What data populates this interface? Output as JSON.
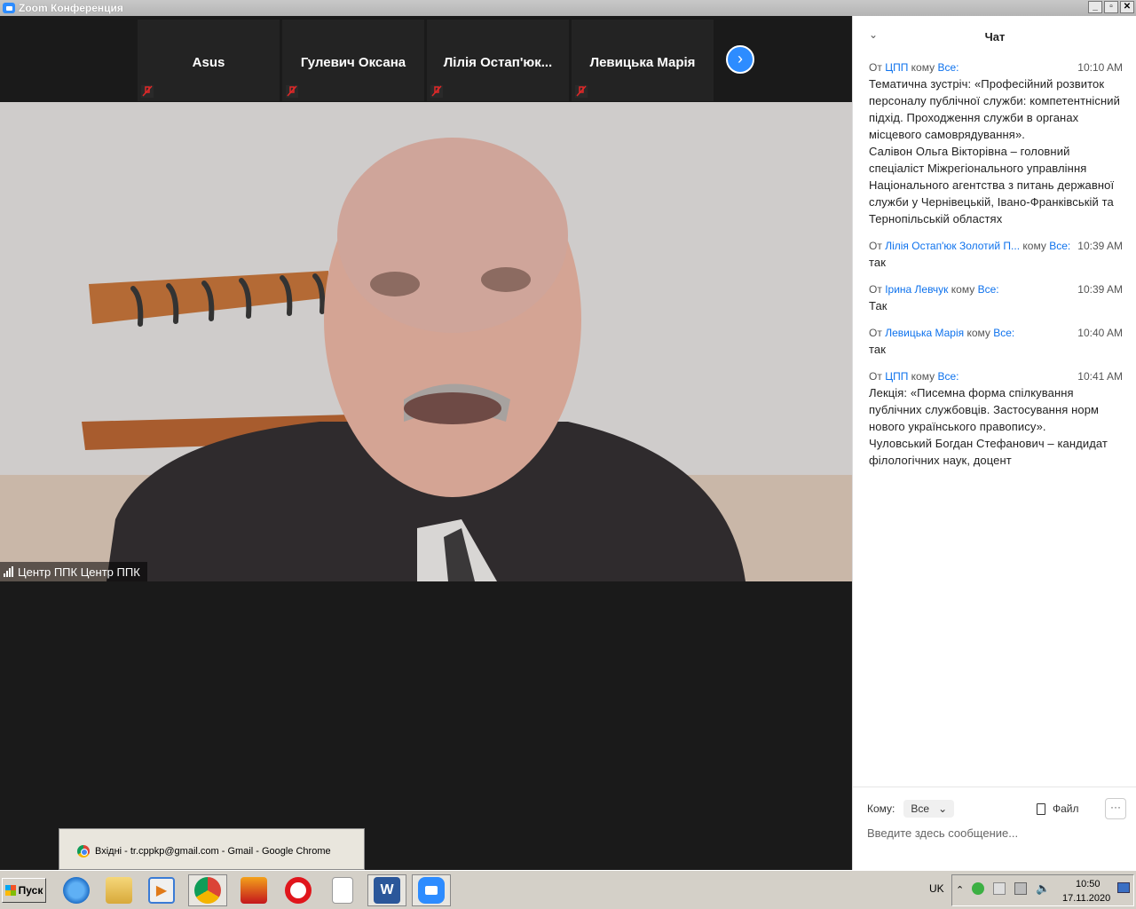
{
  "window": {
    "title": "Zoom Конференция"
  },
  "participants": [
    {
      "name": "Asus"
    },
    {
      "name": "Гулевич Оксана"
    },
    {
      "name": "Лілія  Остап'юк..."
    },
    {
      "name": "Левицька Марія"
    }
  ],
  "speaker": {
    "label": "Центр ППК Центр ППК"
  },
  "chat": {
    "title": "Чат",
    "messages": [
      {
        "from_prefix": "От",
        "from": "ЦПП",
        "to_prefix": "кому",
        "to": "Все:",
        "time": "10:10 AM",
        "text": "Тематична зустріч: «Професійний розвиток персоналу публічної служби: компетентнісний підхід. Проходження служби в органах місцевого самоврядування».\nСалівон Ольга Вікторівна – головний спеціаліст Міжрегіонального управління Національного агентства з питань державної служби у Чернівецькій, Івано-Франківській та Тернопільській областях"
      },
      {
        "from_prefix": "От",
        "from": "Лілія Остап'юк Золотий П...",
        "to_prefix": "кому",
        "to": "Все:",
        "time": "10:39 AM",
        "text": "так"
      },
      {
        "from_prefix": "От",
        "from": "Ірина Левчук",
        "to_prefix": "кому",
        "to": "Все:",
        "time": "10:39 AM",
        "text": "Так"
      },
      {
        "from_prefix": "От",
        "from": "Левицька Марія",
        "to_prefix": "кому",
        "to": "Все:",
        "time": "10:40 AM",
        "text": "так"
      },
      {
        "from_prefix": "От",
        "from": "ЦПП",
        "to_prefix": "кому",
        "to": "Все:",
        "time": "10:41 AM",
        "text": "Лекція: «Писемна форма спілкування публічних службовців. Застосування норм нового українського правопису».\nЧуловський Богдан Стефанович – кандидат філологічних наук, доцент"
      }
    ],
    "composer": {
      "to_label": "Кому:",
      "to_value": "Все",
      "file_label": "Файл",
      "more_label": "···",
      "placeholder": "Введите здесь сообщение..."
    }
  },
  "popup": {
    "text": "Вхідні - tr.cppkp@gmail.com - Gmail - Google Chrome"
  },
  "taskbar": {
    "start_label": "Пуск",
    "lang": "UK",
    "time": "10:50",
    "date": "17.11.2020",
    "icons": [
      "internet-explorer-icon",
      "explorer-icon",
      "media-player-icon",
      "chrome-icon",
      "app-icon",
      "opera-icon",
      "document-icon",
      "word-icon",
      "zoom-icon"
    ]
  },
  "colors": {
    "accent": "#0e72ed",
    "zoom_blue": "#2d8cff",
    "muted_red": "#e02828"
  }
}
